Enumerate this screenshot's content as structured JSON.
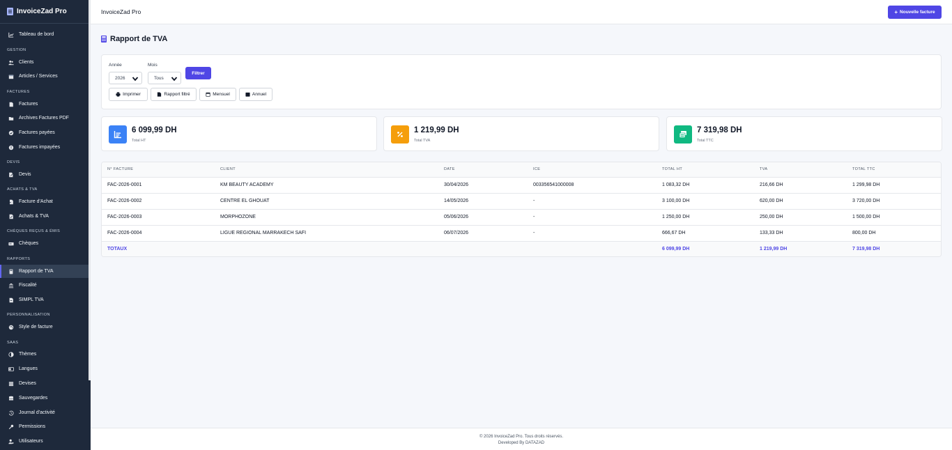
{
  "app": {
    "brand": "InvoiceZad Pro",
    "header_title": "InvoiceZad Pro",
    "new_invoice": "Nouvelle facture",
    "accent": "#4f46e5"
  },
  "sidebar": {
    "dashboard": "Tableau de bord",
    "sections": {
      "gestion": "GESTION",
      "factures": "FACTURES",
      "devis": "DEVIS",
      "achats": "ACHATS & TVA",
      "cheques": "CHÈQUES REÇUS & ÉMIS",
      "rapports": "RAPPORTS",
      "perso": "PERSONNALISATION",
      "saas": "SAAS"
    },
    "items": {
      "clients": "Clients",
      "articles": "Articles / Services",
      "factures": "Factures",
      "archives": "Archives Factures PDF",
      "payees": "Factures payées",
      "impayees": "Factures impayées",
      "devis": "Devis",
      "achat": "Facture d'Achat",
      "achats_tva": "Achats & TVA",
      "cheques": "Chèques",
      "rapport_tva": "Rapport de TVA",
      "fiscalite": "Fiscalité",
      "simpl": "SIMPL TVA",
      "style": "Style de facture",
      "themes": "Thèmes",
      "langues": "Langues",
      "devises": "Devises",
      "sauvegardes": "Sauvegardes",
      "journal": "Journal d'activité",
      "permissions": "Permissions",
      "utilisateurs": "Utilisateurs"
    }
  },
  "page": {
    "title": "Rapport de TVA"
  },
  "filters": {
    "year_label": "Année",
    "year_value": "2026",
    "month_label": "Mois",
    "month_value": "Tous",
    "filter_button": "Filtrer",
    "actions": {
      "print": "Imprimer",
      "filtered": "Rapport filtré",
      "monthly": "Mensuel",
      "annual": "Annuel"
    }
  },
  "stats": [
    {
      "value": "6 099,99 DH",
      "label": "Total HT",
      "color": "#3b82f6",
      "icon": "chart-icon"
    },
    {
      "value": "1 219,99 DH",
      "label": "Total TVA",
      "color": "#f59e0b",
      "icon": "percent-icon"
    },
    {
      "value": "7 319,98 DH",
      "label": "Total TTC",
      "color": "#10b981",
      "icon": "money-icon"
    }
  ],
  "table": {
    "headers": [
      "N° FACTURE",
      "CLIENT",
      "DATE",
      "ICE",
      "TOTAL HT",
      "TVA",
      "TOTAL TTC"
    ],
    "rows": [
      [
        "FAC-2026-0001",
        "KM BEAUTY ACADEMY",
        "30/04/2026",
        "003356541000008",
        "1 083,32 DH",
        "216,66 DH",
        "1 299,98 DH"
      ],
      [
        "FAC-2026-0002",
        "CENTRE EL GHOUAT",
        "14/05/2026",
        "-",
        "3 100,00 DH",
        "620,00 DH",
        "3 720,00 DH"
      ],
      [
        "FAC-2026-0003",
        "MORPHOZONE",
        "05/06/2026",
        "-",
        "1 250,00 DH",
        "250,00 DH",
        "1 500,00 DH"
      ],
      [
        "FAC-2026-0004",
        "LIGUE REGIONAL MARRAKECH SAFI",
        "06/07/2026",
        "-",
        "666,67 DH",
        "133,33 DH",
        "800,00 DH"
      ]
    ],
    "totals": {
      "label": "TOTAUX",
      "ht": "6 099,99 DH",
      "tva": "1 219,99 DH",
      "ttc": "7 319,98 DH"
    }
  },
  "footer": {
    "line1": "© 2026 InvoiceZad Pro. Tous droits réservés.",
    "line2": "Developed By DATAZAD"
  }
}
